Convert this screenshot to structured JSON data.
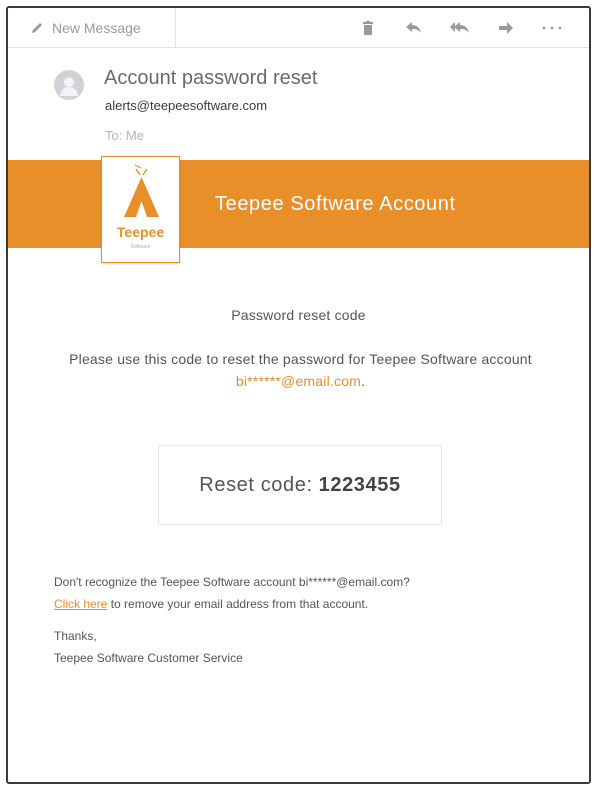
{
  "toolbar": {
    "new_message_label": "New Message",
    "icons": [
      "pencil-icon",
      "trash-icon",
      "reply-icon",
      "reply-all-icon",
      "forward-icon",
      "more-icon"
    ]
  },
  "header": {
    "subject": "Account password reset",
    "sender": "alerts@teepeesoftware.com",
    "to": "To: Me"
  },
  "banner": {
    "title": "Teepee Software Account",
    "logo_text": "Teepee",
    "logo_subtext": "Software",
    "color": "#e88f2a"
  },
  "content": {
    "title": "Password reset code",
    "desc_prefix": "Please use this code to reset the password for Teepee Software account",
    "desc_email": "bi******@email.com",
    "desc_suffix": ".",
    "code_label": "Reset code:",
    "code_value": "1223455"
  },
  "footer": {
    "line1": "Don't recognize the Teepee Software account bi******@email.com?",
    "link": "Click here",
    "line2": "to remove your email address from that account.",
    "thanks": "Thanks,",
    "signature": "Teepee Software Customer Service"
  },
  "colors": {
    "accent": "#e88f2a",
    "text": "#555555",
    "muted": "#b5b5b5"
  }
}
